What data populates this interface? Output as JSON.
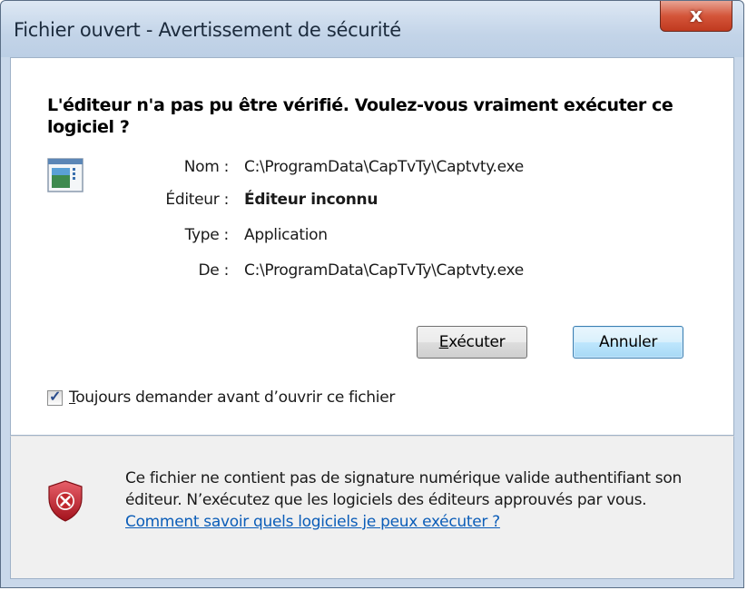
{
  "window": {
    "title": "Fichier ouvert - Avertissement de sécurité",
    "close_glyph": "x"
  },
  "question": "L'éditeur n'a pas pu être vérifié. Voulez-vous vraiment exécuter ce logiciel ?",
  "fields": [
    {
      "label": "Nom :",
      "value": "C:\\ProgramData\\CapTvTy\\Captvty.exe"
    },
    {
      "label": "Éditeur :",
      "value": "Éditeur inconnu"
    },
    {
      "label": "Type :",
      "value": "Application"
    },
    {
      "label": "De :",
      "value": "C:\\ProgramData\\CapTvTy\\Captvty.exe"
    }
  ],
  "buttons": {
    "run_accel": "E",
    "run_rest": "xécuter",
    "cancel": "Annuler"
  },
  "checkbox": {
    "checked": true,
    "label_accel": "T",
    "label_rest": "oujours demander avant d’ouvrir ce fichier"
  },
  "notice": {
    "text": "Ce fichier ne contient pas de signature numérique valide authentifiant son éditeur. N’exécutez que les logiciels des éditeurs approuvés par vous. ",
    "link": "Comment savoir quels logiciels je peux exécuter ?"
  },
  "colors": {
    "title_bar": "#c9d8ea",
    "close_button": "#c8452a",
    "link": "#0b5db8",
    "shield": "#c0272d"
  }
}
